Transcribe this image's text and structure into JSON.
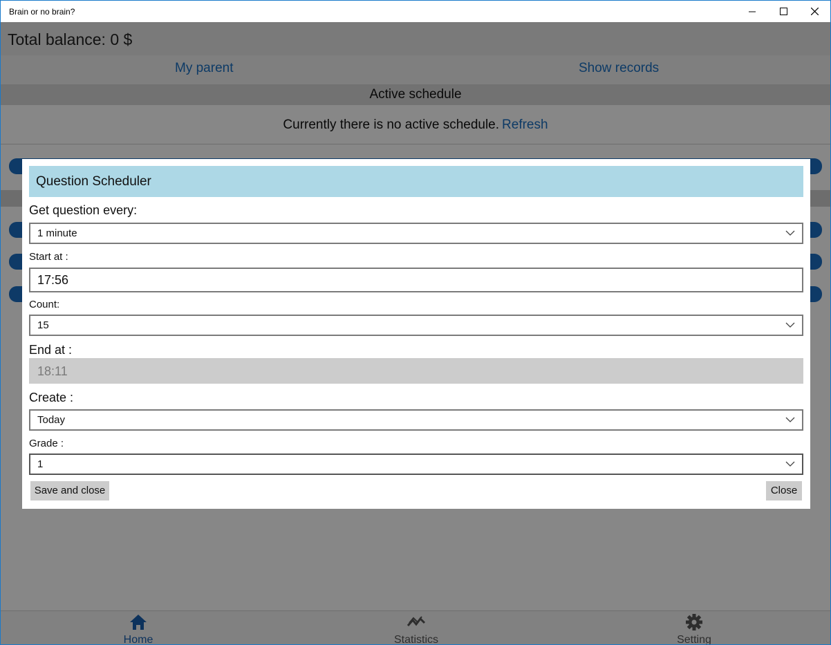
{
  "window": {
    "title": "Brain or no brain?",
    "minimize_icon": "minimize-icon",
    "maximize_icon": "maximize-icon",
    "close_icon": "close-icon"
  },
  "header": {
    "balance": "Total balance: 0 $"
  },
  "nav": {
    "my_parent": "My parent",
    "show_records": "Show records"
  },
  "schedule": {
    "title": "Active schedule",
    "message": "Currently there is no active schedule.",
    "refresh": "Refresh"
  },
  "dialog": {
    "title": "Question Scheduler",
    "frequency_label": "Get question every:",
    "frequency_value": "1 minute",
    "start_label": "Start at :",
    "start_value": "17:56",
    "count_label": "Count:",
    "count_value": "15",
    "end_label": "End at :",
    "end_value": "18:11",
    "create_label": "Create :",
    "create_value": "Today",
    "grade_label": "Grade :",
    "grade_value": "1",
    "save_button": "Save and close",
    "close_button": "Close"
  },
  "bottom_nav": {
    "items": [
      {
        "label": "Home",
        "icon": "home-icon",
        "active": true
      },
      {
        "label": "Statistics",
        "icon": "statistics-icon",
        "active": false
      },
      {
        "label": "Setting",
        "icon": "gear-icon",
        "active": false
      }
    ]
  },
  "colors": {
    "accent": "#1a6fc0",
    "dialog_header": "#add8e6",
    "overlay": "rgba(0,0,0,0.47)"
  }
}
